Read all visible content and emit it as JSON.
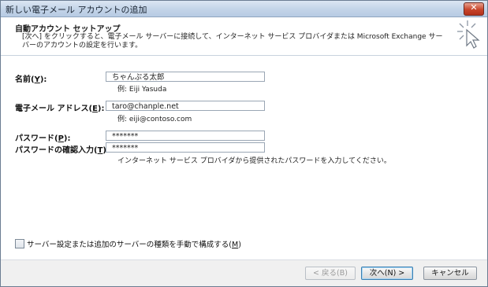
{
  "window": {
    "title": "新しい電子メール アカウントの追加",
    "close_label": "✕"
  },
  "header": {
    "title": "自動アカウント セットアップ",
    "description": "[次へ] をクリックすると、電子メール サーバーに接続して、インターネット サービス プロバイダまたは Microsoft Exchange サーバーのアカウントの設定を行います。"
  },
  "form": {
    "name": {
      "label_pre": "名前(",
      "accel": "Y",
      "label_post": "):",
      "value": "ちゃんぷる太郎",
      "hint": "例: Eiji Yasuda"
    },
    "email": {
      "label_pre": "電子メール アドレス(",
      "accel": "E",
      "label_post": "):",
      "value": "taro@chanple.net",
      "hint": "例: eiji@contoso.com"
    },
    "password": {
      "label_pre": "パスワード(",
      "accel": "P",
      "label_post": "):",
      "value": "*******"
    },
    "password_confirm": {
      "label_pre": "パスワードの確認入力(",
      "accel": "T",
      "label_post": "):",
      "value": "*******",
      "hint": "インターネット サービス プロバイダから提供されたパスワードを入力してください。"
    }
  },
  "manual_setup": {
    "label_pre": "サーバー設定または追加のサーバーの種類を手動で構成する(",
    "accel": "M",
    "label_post": ")",
    "checked": false
  },
  "buttons": {
    "back": "< 戻る(B)",
    "next": "次へ(N) >",
    "cancel": "キャンセル"
  }
}
